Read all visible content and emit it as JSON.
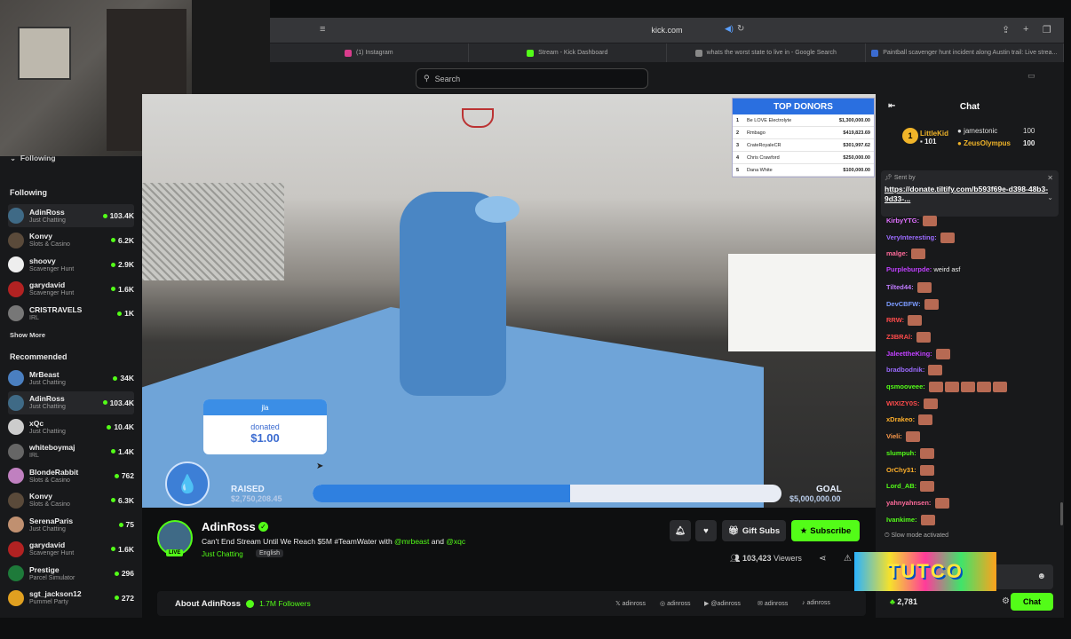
{
  "browser": {
    "url": "kick.com",
    "tabs": [
      {
        "label": "(1) Instagram",
        "color": "#d93c8c"
      },
      {
        "label": "Stream - Kick Dashboard",
        "color": "#53fc18"
      },
      {
        "label": "whats the worst state to live in - Google Search",
        "color": "#888888"
      },
      {
        "label": "Paintball scavenger hunt incident along Austin trail: Live strea...",
        "color": "#3b6bd0"
      }
    ]
  },
  "search": {
    "placeholder": "Search"
  },
  "sidebar": {
    "following_toggle": "Following",
    "following_header": "Following",
    "following": [
      {
        "name": "AdinRoss",
        "category": "Just Chatting",
        "viewers": "103.4K",
        "color": "#3f6a86",
        "highlight": true
      },
      {
        "name": "Konvy",
        "category": "Slots & Casino",
        "viewers": "6.2K",
        "color": "#5a4a3a"
      },
      {
        "name": "shoovy",
        "category": "Scavenger Hunt",
        "viewers": "2.9K",
        "color": "#eeeeee"
      },
      {
        "name": "garydavid",
        "category": "Scavenger Hunt",
        "viewers": "1.6K",
        "color": "#b22222"
      },
      {
        "name": "CRISTRAVELS",
        "category": "IRL",
        "viewers": "1K",
        "color": "#777777"
      }
    ],
    "show_more_1": "Show More",
    "recommended_header": "Recommended",
    "recommended": [
      {
        "name": "MrBeast",
        "category": "Just Chatting",
        "viewers": "34K",
        "color": "#4a7fc0"
      },
      {
        "name": "AdinRoss",
        "category": "Just Chatting",
        "viewers": "103.4K",
        "color": "#3f6a86",
        "highlight": true
      },
      {
        "name": "xQc",
        "category": "Just Chatting",
        "viewers": "10.4K",
        "color": "#cccccc"
      },
      {
        "name": "whiteboymaj",
        "category": "IRL",
        "viewers": "1.4K",
        "color": "#666666"
      },
      {
        "name": "BlondeRabbit",
        "category": "Slots & Casino",
        "viewers": "762",
        "color": "#c080c0"
      },
      {
        "name": "Konvy",
        "category": "Slots & Casino",
        "viewers": "6.3K",
        "color": "#5a4a3a"
      },
      {
        "name": "SerenaParis",
        "category": "Just Chatting",
        "viewers": "75",
        "color": "#c09070"
      },
      {
        "name": "garydavid",
        "category": "Scavenger Hunt",
        "viewers": "1.6K",
        "color": "#b22222"
      },
      {
        "name": "Prestige",
        "category": "Parcel Simulator",
        "viewers": "296",
        "color": "#1e7a3a"
      },
      {
        "name": "sgt_jackson12",
        "category": "Pummel Party",
        "viewers": "272",
        "color": "#e0a020"
      }
    ]
  },
  "overlay": {
    "top_donors_title": "TOP DONORS",
    "top_donors": [
      {
        "rank": "1",
        "name": "Be LOVE Electrolyte",
        "amount": "$1,300,000.00"
      },
      {
        "rank": "2",
        "name": "Rmbago",
        "amount": "$419,823.69"
      },
      {
        "rank": "3",
        "name": "CrateRoyaleCR",
        "amount": "$301,997.62"
      },
      {
        "rank": "4",
        "name": "Chris Crawford",
        "amount": "$250,000.00"
      },
      {
        "rank": "5",
        "name": "Dana White",
        "amount": "$100,000.00"
      }
    ],
    "alert_user": "jla",
    "alert_label": "donated",
    "alert_amount": "$1.00",
    "raised_label": "RAISED",
    "raised_value": "$2,750,208.45",
    "goal_label": "GOAL",
    "goal_value": "$5,000,000.00",
    "progress_fraction": 0.55
  },
  "stream": {
    "name": "AdinRoss",
    "live": "LIVE",
    "title_prefix": "Can't End Stream Until We Reach $5M #TeamWater with ",
    "mention1": "@mrbeast",
    "and": " and ",
    "mention2": "@xqc",
    "category": "Just Chatting",
    "language": "English",
    "gift_subs": "Gift Subs",
    "subscribe": "Subscribe",
    "viewers": "103,423",
    "viewers_label": "Viewers",
    "about": "About AdinRoss",
    "followers": "1.7M Followers",
    "socials": [
      "adinross",
      "adinross",
      "@adinross",
      "adinross",
      "adinross"
    ]
  },
  "chat": {
    "title": "Chat",
    "top_gifters": [
      {
        "rank": "1",
        "name": "LittleKid",
        "count": "101"
      },
      {
        "name": "jamestonic",
        "count": "100"
      },
      {
        "name": "ZeusOlympus",
        "count": "100"
      }
    ],
    "pinned_by": "Sent by",
    "pinned_link": "https://donate.tiltify.com/b593f69e-d398-48b3-9d33-...",
    "messages": [
      {
        "user": "KirbyYTG:",
        "text": "",
        "color": "#e070ff",
        "emotes": 1
      },
      {
        "user": "VeryInteresting:",
        "text": "",
        "color": "#9b6bff",
        "emotes": 1
      },
      {
        "user": "malge:",
        "text": "",
        "color": "#ff6b9b",
        "emotes": 1
      },
      {
        "user": "Purpleburpde:",
        "text": "weird asf",
        "color": "#c040ff",
        "emotes": 0
      },
      {
        "user": "Tilted44:",
        "text": "",
        "color": "#c07bff",
        "emotes": 1
      },
      {
        "user": "DevCBFW:",
        "text": "",
        "color": "#7b9bff",
        "emotes": 1
      },
      {
        "user": "RRW:",
        "text": "",
        "color": "#ff4b4b",
        "emotes": 1
      },
      {
        "user": "Z3BRAl:",
        "text": "",
        "color": "#ff4b4b",
        "emotes": 1
      },
      {
        "user": "JaleettheKing:",
        "text": "",
        "color": "#c040ff",
        "emotes": 1
      },
      {
        "user": "bradbodnik:",
        "text": "",
        "color": "#9b6bff",
        "emotes": 1
      },
      {
        "user": "qsmooveee:",
        "text": "",
        "color": "#53fc18",
        "emotes": 5
      },
      {
        "user": "WIXIZY0S:",
        "text": "",
        "color": "#ff4b4b",
        "emotes": 1
      },
      {
        "user": "xDrakeo:",
        "text": "",
        "color": "#ffb02b",
        "emotes": 1
      },
      {
        "user": "Vieli:",
        "text": "",
        "color": "#ff9b4b",
        "emotes": 1
      },
      {
        "user": "slumpuh:",
        "text": "",
        "color": "#53fc18",
        "emotes": 1
      },
      {
        "user": "OrChy31:",
        "text": "",
        "color": "#ffb02b",
        "emotes": 1
      },
      {
        "user": "Lord_AB:",
        "text": "",
        "color": "#53fc18",
        "emotes": 1
      },
      {
        "user": "yahnyahnsen:",
        "text": "",
        "color": "#ff6b9b",
        "emotes": 1
      },
      {
        "user": "Ivankime:",
        "text": "",
        "color": "#53fc18",
        "emotes": 1
      }
    ],
    "slow_mode": "Slow mode activated",
    "points": "2,781",
    "chat_button": "Chat",
    "sticker_text": "TUTCO"
  }
}
